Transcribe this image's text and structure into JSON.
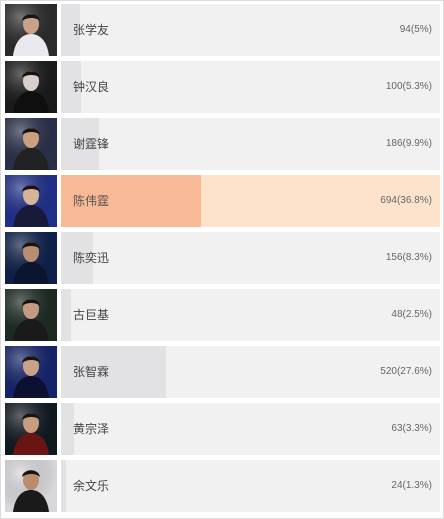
{
  "poll": {
    "options": [
      {
        "name": "张学友",
        "count_text": "94(5%)",
        "percent": 5.0,
        "selected": false,
        "photo": "singer-photo",
        "bg": "#2b2b2b",
        "skin": "#c9a08a",
        "cloth": "#e9e9ee"
      },
      {
        "name": "钟汉良",
        "count_text": "100(5.3%)",
        "percent": 5.3,
        "selected": false,
        "photo": "singer-photo",
        "bg": "#1a1a1a",
        "skin": "#d8d0cc",
        "cloth": "#0f0f0f"
      },
      {
        "name": "谢霆锋",
        "count_text": "186(9.9%)",
        "percent": 9.9,
        "selected": false,
        "photo": "singer-photo",
        "bg": "#2a2f4a",
        "skin": "#caa07e",
        "cloth": "#222"
      },
      {
        "name": "陈伟霆",
        "count_text": "694(36.8%)",
        "percent": 36.8,
        "selected": true,
        "photo": "singer-photo",
        "bg": "#1f2f8a",
        "skin": "#d7b39a",
        "cloth": "#181a3a"
      },
      {
        "name": "陈奕迅",
        "count_text": "156(8.3%)",
        "percent": 8.3,
        "selected": false,
        "photo": "singer-photo",
        "bg": "#0e1f4a",
        "skin": "#b98d70",
        "cloth": "#0b1530"
      },
      {
        "name": "古巨基",
        "count_text": "48(2.5%)",
        "percent": 2.5,
        "selected": false,
        "photo": "singer-photo",
        "bg": "#1c2a22",
        "skin": "#c49b80",
        "cloth": "#1a1a1a"
      },
      {
        "name": "张智霖",
        "count_text": "520(27.6%)",
        "percent": 27.6,
        "selected": false,
        "photo": "singer-photo",
        "bg": "#15246a",
        "skin": "#caa288",
        "cloth": "#0d1030"
      },
      {
        "name": "黄宗泽",
        "count_text": "63(3.3%)",
        "percent": 3.3,
        "selected": false,
        "photo": "singer-photo",
        "bg": "#101820",
        "skin": "#c89c7e",
        "cloth": "#6a1414"
      },
      {
        "name": "余文乐",
        "count_text": "24(1.3%)",
        "percent": 1.3,
        "selected": false,
        "photo": "singer-photo",
        "bg": "#d8d8dc",
        "skin": "#b88c6c",
        "cloth": "#1a1a1a"
      }
    ]
  }
}
